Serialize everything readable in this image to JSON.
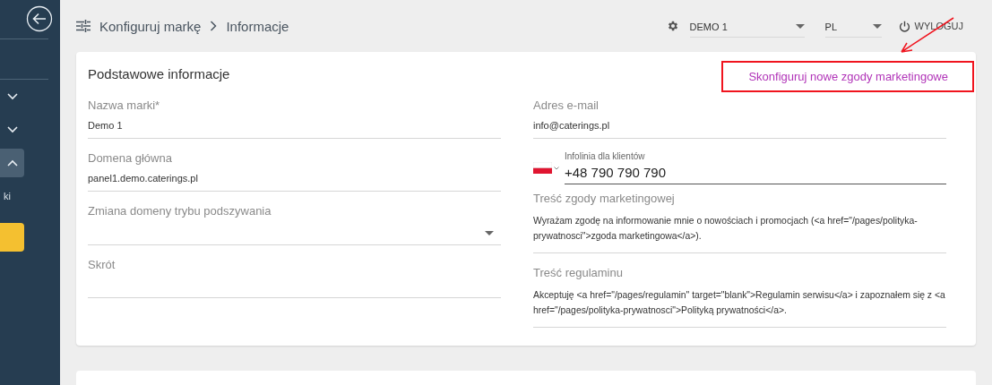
{
  "sidebar": {
    "items": [
      {
        "kind": "dropdown",
        "expanded": false
      },
      {
        "kind": "dropdown",
        "expanded": false
      },
      {
        "kind": "dropdown",
        "expanded": true
      },
      {
        "kind": "text",
        "label": "ki"
      },
      {
        "kind": "button"
      }
    ]
  },
  "header": {
    "breadcrumb": [
      "Konfiguruj markę",
      "Informacje"
    ],
    "brand_select": {
      "value": "DEMO 1"
    },
    "language_select": {
      "value": "PL"
    },
    "logout": "WYLOGUJ"
  },
  "card": {
    "title": "Podstawowe informacje",
    "link": "Skonfiguruj nowe zgody marketingowe",
    "left_fields": [
      {
        "kind": "text",
        "label": "Nazwa marki*",
        "value": "Demo 1"
      },
      {
        "kind": "text",
        "label": "Domena główna",
        "value": "panel1.demo.caterings.pl"
      },
      {
        "kind": "select",
        "label": "Zmiana domeny trybu podszywania"
      },
      {
        "kind": "text",
        "label": "Skrót"
      }
    ],
    "right_fields": [
      {
        "kind": "text",
        "label": "Adres e-mail",
        "value": "info@caterings.pl"
      },
      {
        "kind": "phone",
        "label": "Infolinia dla klientów",
        "value": "+48 790 790 790"
      },
      {
        "kind": "textarea",
        "label": "Treść zgody marketingowej",
        "value": "Wyrażam zgodę na informowanie mnie o nowościach i promocjach (<a href=\"/pages/polityka-prywatnosci\">zgoda marketingowa</a>)."
      },
      {
        "kind": "textarea",
        "label": "Treść regulaminu",
        "value": "Akceptuję <a href=\"/pages/regulamin\" target=\"blank\">Regulamin serwisu</a> i zapoznałem się z <a href=\"/pages/polityka-prywatnosci\">Polityką prywatności</a>."
      }
    ]
  }
}
